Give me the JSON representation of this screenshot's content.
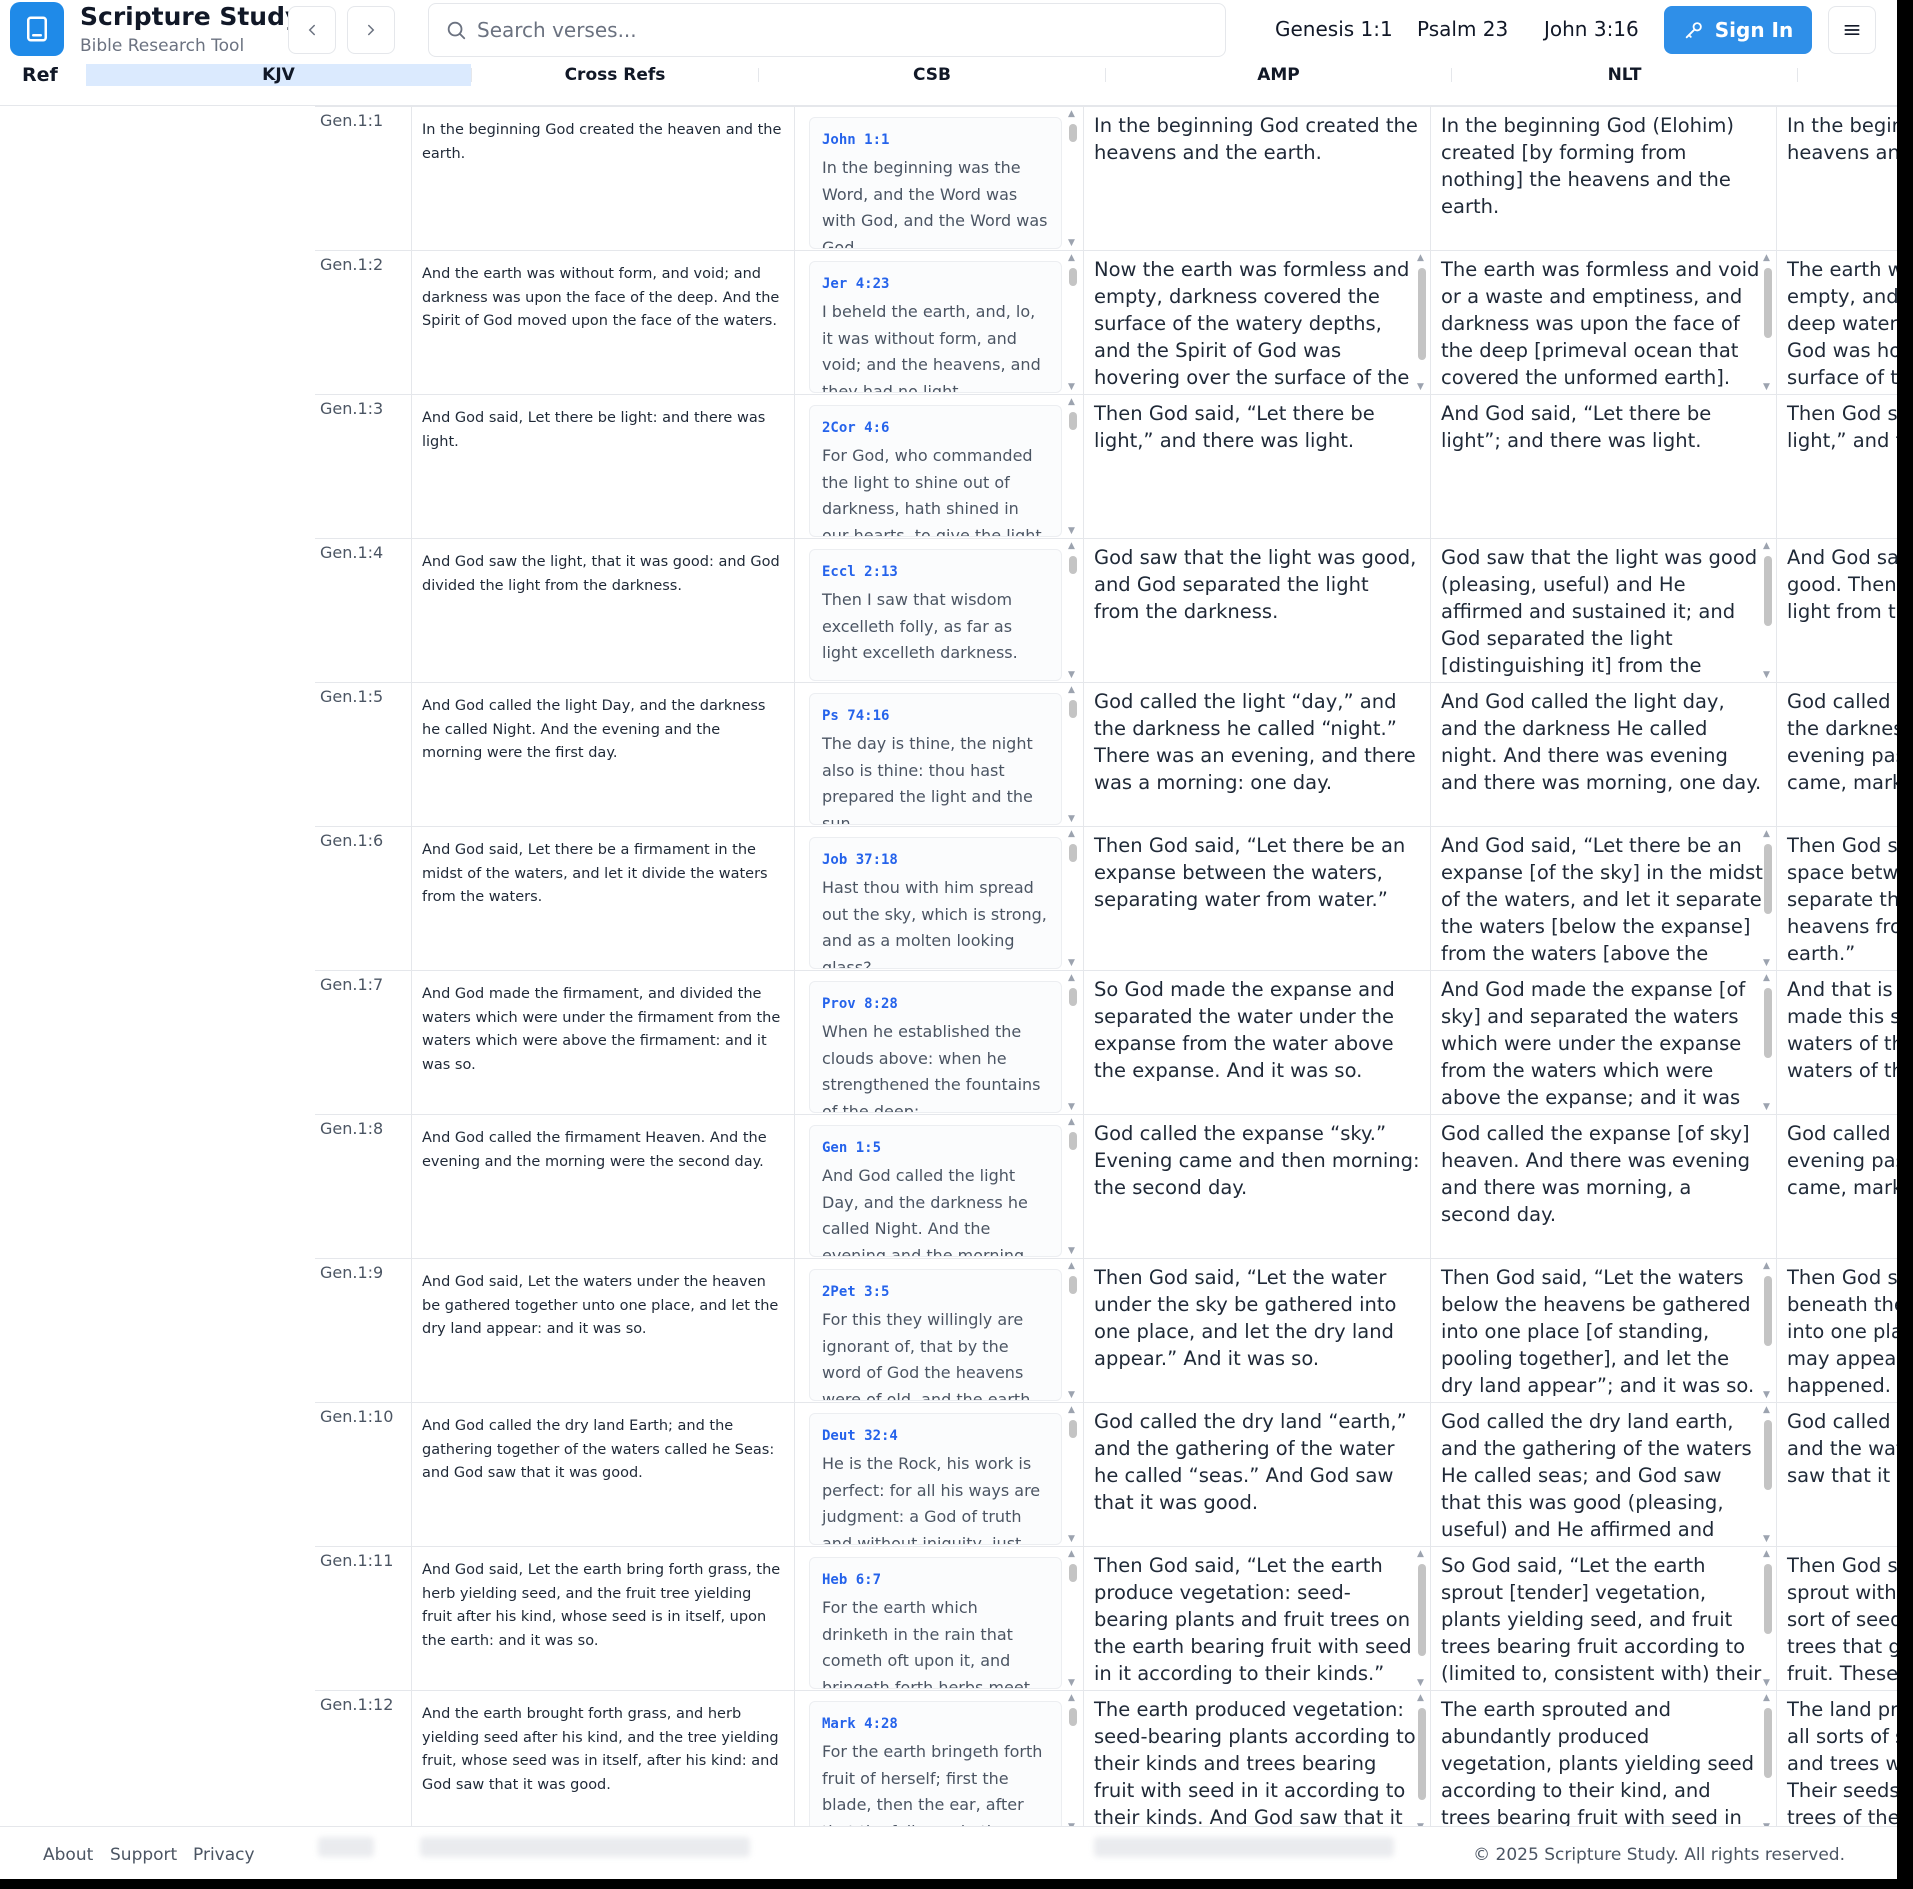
{
  "header": {
    "app_title": "Scripture Study",
    "app_subtitle": "Bible Research Tool",
    "search_placeholder": "Search verses...",
    "quick_links": [
      "Genesis 1:1",
      "Psalm 23",
      "John 3:16"
    ],
    "signin_label": "Sign In",
    "accent_color": "#2f8fe8"
  },
  "columns": {
    "ref": "Ref",
    "kjv": "KJV",
    "xref": "Cross Refs",
    "csb": "CSB",
    "amp": "AMP",
    "nlt": "NLT"
  },
  "rows": [
    {
      "ref": "Gen.1:1",
      "kjv": "In the beginning God created the heaven and the earth.",
      "xref_ref": "John 1:1",
      "xref_text": "In the beginning was the Word, and the Word was with God, and the Word was God.",
      "csb": "In the beginning God created the heavens and the earth.",
      "amp": "In the beginning God (Elohim) created [by forming from nothing] the heavens and the earth.",
      "nlt": "In the beginning God created the heavens and the earth."
    },
    {
      "ref": "Gen.1:2",
      "kjv": "And the earth was without form, and void; and darkness was upon the face of the deep. And the Spirit of God moved upon the face of the waters.",
      "xref_ref": "Jer 4:23",
      "xref_text": "I beheld the earth, and, lo, it was without form, and void; and the heavens, and they had no light.",
      "csb": "Now the earth was formless and empty, darkness covered the surface of the watery depths, and the Spirit of God was hovering over the surface of the waters.",
      "amp": "The earth was formless and void or a waste and emptiness, and darkness was upon the face of the deep [primeval ocean that covered the unformed earth]. The Spirit of God was moving (hovering, brooding) over the face of the waters.",
      "nlt": "The earth was formless and empty, and darkness covered the deep waters. And the Spirit of God was hovering over the surface of the waters."
    },
    {
      "ref": "Gen.1:3",
      "kjv": "And God said, Let there be light: and there was light.",
      "xref_ref": "2Cor 4:6",
      "xref_text": "For God, who commanded the light to shine out of darkness, hath shined in our hearts, to give the light of the knowledge of the glory of God.",
      "csb": "Then God said, “Let there be light,” and there was light.",
      "amp": "And God said, “Let there be light”; and there was light.",
      "nlt": "Then God said, “Let there be light,” and there was light."
    },
    {
      "ref": "Gen.1:4",
      "kjv": "And God saw the light, that it was good: and God divided the light from the darkness.",
      "xref_ref": "Eccl 2:13",
      "xref_text": "Then I saw that wisdom excelleth folly, as far as light excelleth darkness.",
      "csb": "God saw that the light was good, and God separated the light from the darkness.",
      "amp": "God saw that the light was good (pleasing, useful) and He affirmed and sustained it; and God separated the light [distinguishing it] from the darkness.",
      "nlt": "And God saw that the light was good. Then he separated the light from the darkness."
    },
    {
      "ref": "Gen.1:5",
      "kjv": "And God called the light Day, and the darkness he called Night. And the evening and the morning were the first day.",
      "xref_ref": "Ps 74:16",
      "xref_text": "The day is thine, the night also is thine: thou hast prepared the light and the sun.",
      "csb": "God called the light “day,” and the darkness he called “night.” There was an evening, and there was a morning: one day.",
      "amp": "And God called the light day, and the darkness He called night. And there was evening and there was morning, one day.",
      "nlt": "God called the light “day” and the darkness “night.” And evening passed and morning came, marking the first day."
    },
    {
      "ref": "Gen.1:6",
      "kjv": "And God said, Let there be a firmament in the midst of the waters, and let it divide the waters from the waters.",
      "xref_ref": "Job 37:18",
      "xref_text": "Hast thou with him spread out the sky, which is strong, and as a molten looking glass?",
      "csb": "Then God said, “Let there be an expanse between the waters, separating water from water.”",
      "amp": "And God said, “Let there be an expanse [of the sky] in the midst of the waters, and let it separate the waters [below the expanse] from the waters [above the expanse].”",
      "nlt": "Then God said, “Let there be a space between the waters, to separate the waters of the heavens from the waters of the earth.”"
    },
    {
      "ref": "Gen.1:7",
      "kjv": "And God made the firmament, and divided the waters which were under the firmament from the waters which were above the firmament: and it was so.",
      "xref_ref": "Prov 8:28",
      "xref_text": "When he established the clouds above: when he strengthened the fountains of the deep:",
      "csb": "So God made the expanse and separated the water under the expanse from the water above the expanse. And it was so.",
      "amp": "And God made the expanse [of sky] and separated the waters which were under the expanse from the waters which were above the expanse; and it was so [just as He commanded].",
      "nlt": "And that is what happened. God made this space to separate the waters of the earth from the waters of the heavens."
    },
    {
      "ref": "Gen.1:8",
      "kjv": "And God called the firmament Heaven. And the evening and the morning were the second day.",
      "xref_ref": "Gen 1:5",
      "xref_text": "And God called the light Day, and the darkness he called Night. And the evening and the morning were the first day.",
      "csb": "God called the expanse “sky.” Evening came and then morning: the second day.",
      "amp": "God called the expanse [of sky] heaven. And there was evening and there was morning, a second day.",
      "nlt": "God called the space “sky.” And evening passed and morning came, marking the second day."
    },
    {
      "ref": "Gen.1:9",
      "kjv": "And God said, Let the waters under the heaven be gathered together unto one place, and let the dry land appear: and it was so.",
      "xref_ref": "2Pet 3:5",
      "xref_text": "For this they willingly are ignorant of, that by the word of God the heavens were of old, and the earth standing out of the water.",
      "csb": "Then God said, “Let the water under the sky be gathered into one place, and let the dry land appear.” And it was so.",
      "amp": "Then God said, “Let the waters below the heavens be gathered into one place [of standing, pooling together], and let the dry land appear”; and it was so.",
      "nlt": "Then God said, “Let the waters beneath the sky flow together into one place, so dry ground may appear.” And that is what happened."
    },
    {
      "ref": "Gen.1:10",
      "kjv": "And God called the dry land Earth; and the gathering together of the waters called he Seas: and God saw that it was good.",
      "xref_ref": "Deut 32:4",
      "xref_text": "He is the Rock, his work is perfect: for all his ways are judgment: a God of truth and without iniquity, just and right is he.",
      "csb": "God called the dry land “earth,” and the gathering of the water he called “seas.” And God saw that it was good.",
      "amp": "God called the dry land earth, and the gathering of the waters He called seas; and God saw that this was good (pleasing, useful) and He affirmed and sustained it.",
      "nlt": "God called the dry ground “land” and the waters “seas.” And God saw that it was good."
    },
    {
      "ref": "Gen.1:11",
      "kjv": "And God said, Let the earth bring forth grass, the herb yielding seed, and the fruit tree yielding fruit after his kind, whose seed is in itself, upon the earth: and it was so.",
      "xref_ref": "Heb 6:7",
      "xref_text": "For the earth which drinketh in the rain that cometh oft upon it, and bringeth forth herbs meet for them by whom it is dressed.",
      "csb": "Then God said, “Let the earth produce vegetation: seed-bearing plants and fruit trees on the earth bearing fruit with seed in it according to their kinds.” And it was so.",
      "amp": "So God said, “Let the earth sprout [tender] vegetation, plants yielding seed, and fruit trees bearing fruit according to (limited to, consistent with) their kind, whose seed is in them upon the earth”; and it was so.",
      "nlt": "Then God said, “Let the land sprout with vegetation—every sort of seed-bearing plant, and trees that grow seed-bearing fruit. These seeds will then produce the kinds of plants and trees from which they came.”"
    },
    {
      "ref": "Gen.1:12",
      "kjv": "And the earth brought forth grass, and herb yielding seed after his kind, and the tree yielding fruit, whose seed was in itself, after his kind: and God saw that it was good.",
      "xref_ref": "Mark 4:28",
      "xref_text": "For the earth bringeth forth fruit of herself; first the blade, then the ear, after that the full corn in the ear.",
      "csb": "The earth produced vegetation: seed-bearing plants according to their kinds and trees bearing fruit with seed in it according to their kinds. And God saw that it was good.",
      "amp": "The earth sprouted and abundantly produced vegetation, plants yielding seed according to their kind, and trees bearing fruit with seed in them, according to their kind; and God saw that it was good.",
      "nlt": "The land produced vegetation—all sorts of seed-bearing plants, and trees with seed-bearing fruit. Their seeds produced plants and trees of the same kind. And God saw that it was good."
    }
  ],
  "footer": {
    "links": [
      "About",
      "Support",
      "Privacy"
    ],
    "copyright": "© 2025 Scripture Study. All rights reserved."
  }
}
